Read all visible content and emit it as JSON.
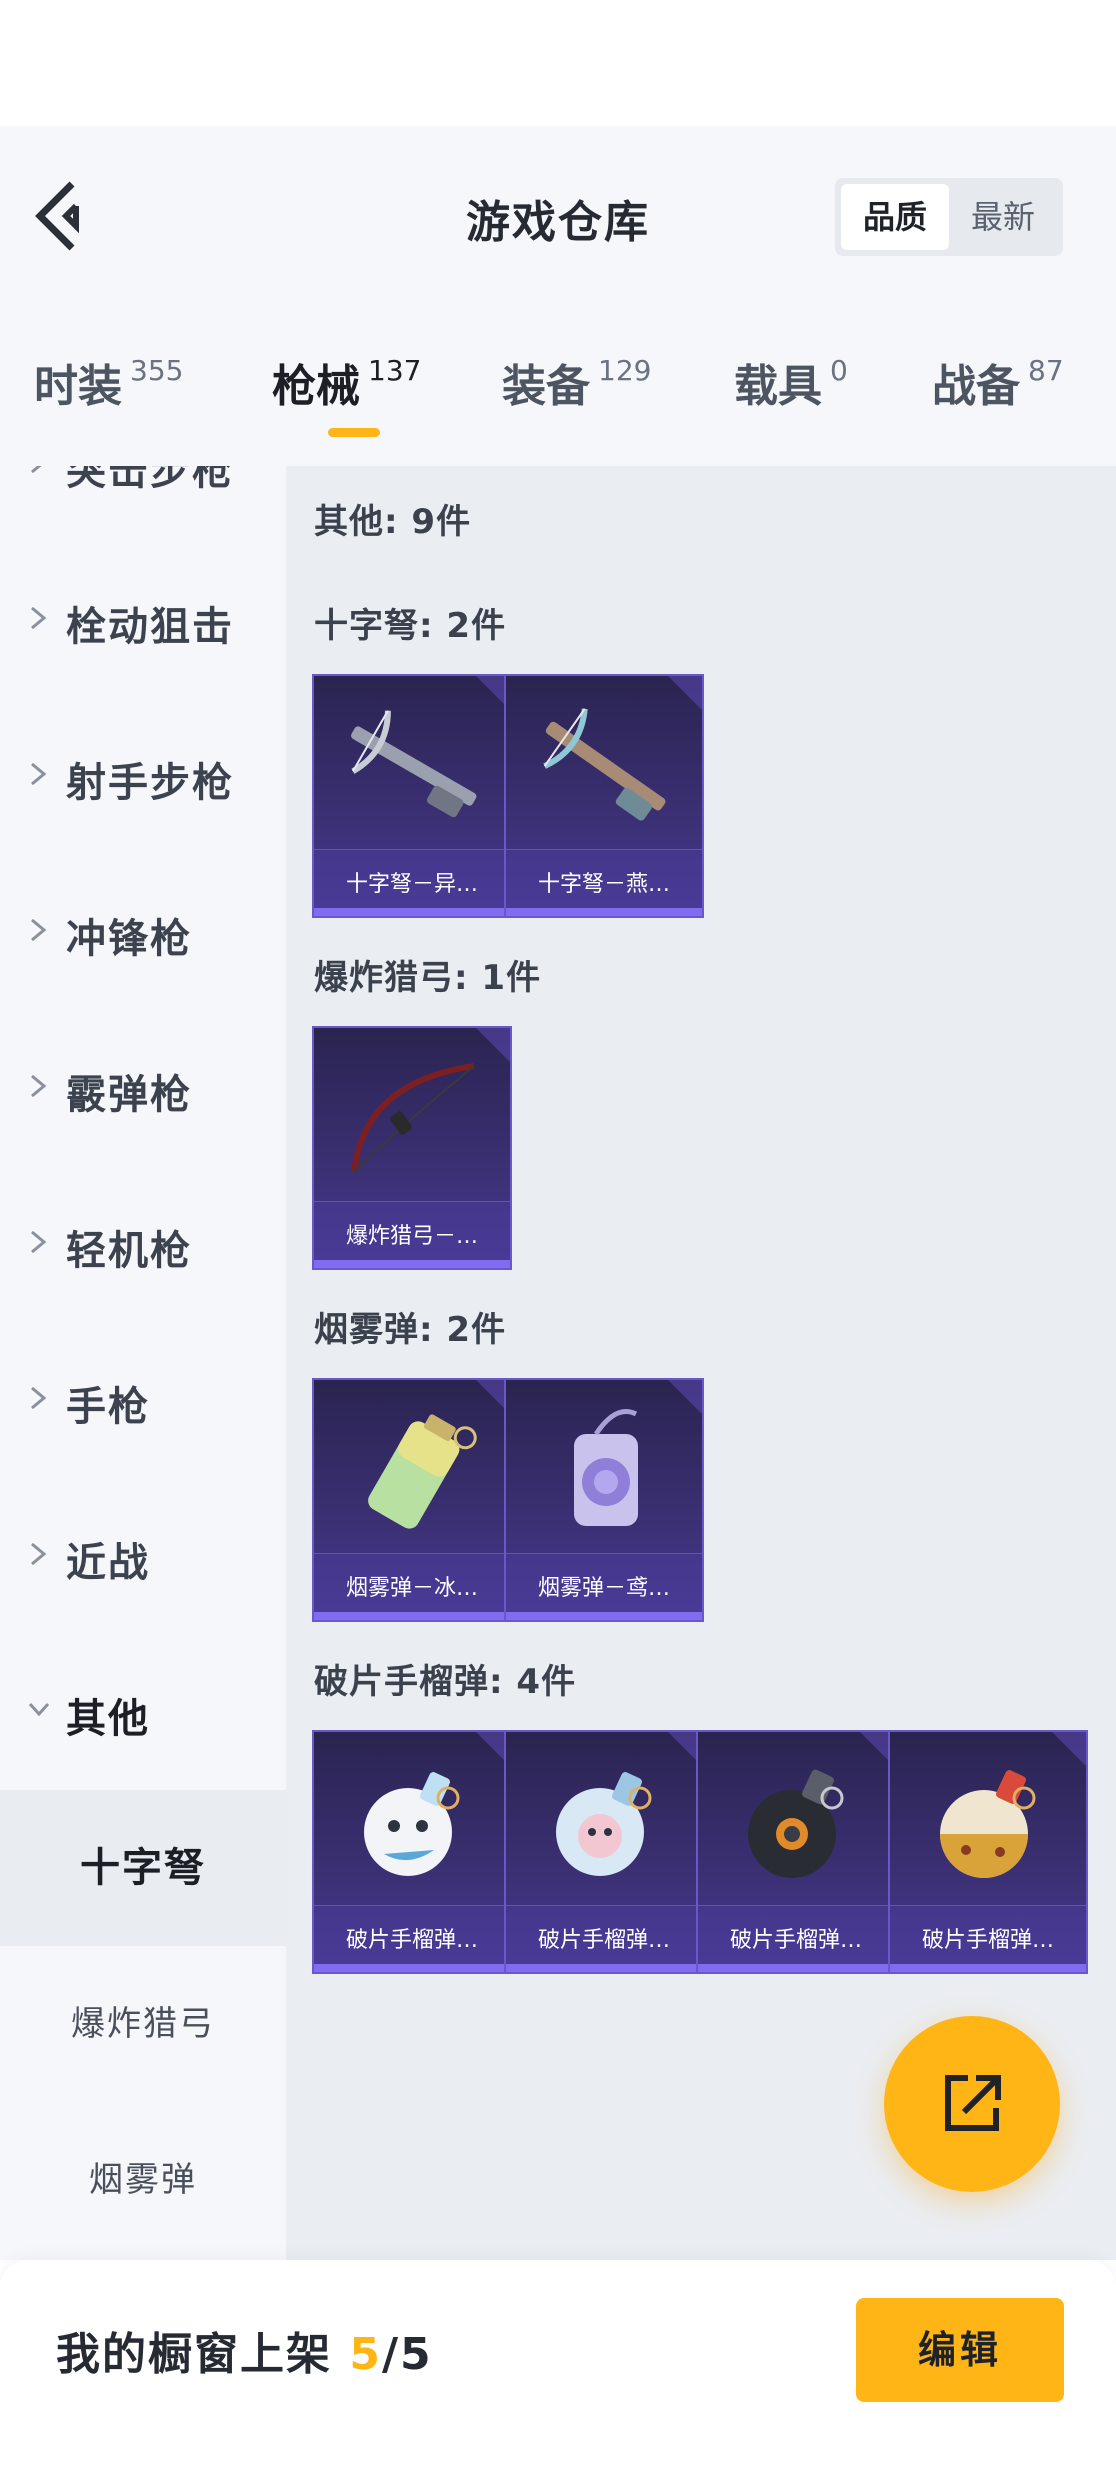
{
  "header": {
    "title": "游戏仓库",
    "sort_options": [
      "品质",
      "最新"
    ]
  },
  "tabs": [
    {
      "label": "时装",
      "count": "355"
    },
    {
      "label": "枪械",
      "count": "137",
      "active": true
    },
    {
      "label": "装备",
      "count": "129"
    },
    {
      "label": "载具",
      "count": "0"
    },
    {
      "label": "战备",
      "count": "87"
    }
  ],
  "sidebar": {
    "items": [
      "突击步枪",
      "栓动狙击",
      "射手步枪",
      "冲锋枪",
      "霰弹枪",
      "轻机枪",
      "手枪",
      "近战",
      "其他"
    ],
    "sub_items": [
      "十字弩",
      "爆炸猎弓",
      "烟雾弹"
    ],
    "active_sub": "十字弩"
  },
  "main": {
    "summary": "其他: 9件",
    "sections": [
      {
        "title": "十字弩: 2件",
        "items": [
          "十字弩－异…",
          "十字弩－燕…"
        ]
      },
      {
        "title": "爆炸猎弓: 1件",
        "items": [
          "爆炸猎弓－…"
        ]
      },
      {
        "title": "烟雾弹: 2件",
        "items": [
          "烟雾弹－冰…",
          "烟雾弹－鸢…"
        ]
      },
      {
        "title": "破片手榴弹: 4件",
        "items": [
          "破片手榴弹…",
          "破片手榴弹…",
          "破片手榴弹…",
          "破片手榴弹…"
        ]
      }
    ]
  },
  "footer": {
    "showcase_label": "我的橱窗上架 ",
    "showcase_current": "5",
    "showcase_total": "/5",
    "edit_label": "编辑"
  },
  "colors": {
    "accent": "#ffb515",
    "card_bg": "#3d3178",
    "card_border": "#6a58c8",
    "rarity_bar": "#7f6cf0"
  },
  "icons": [
    "back-arrow-icon",
    "chevron-right-icon",
    "chevron-down-icon",
    "share-external-icon"
  ]
}
